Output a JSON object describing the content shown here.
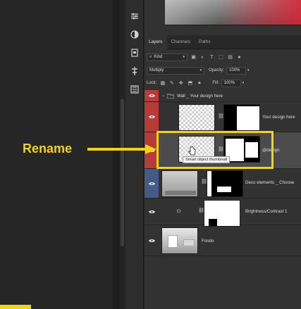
{
  "panel_tabs": [
    "Layers",
    "Channels",
    "Paths"
  ],
  "filter": {
    "kind_label": "Kind"
  },
  "blend": {
    "mode": "Multiply",
    "opacity_label": "Opacity:",
    "opacity_value": "100%"
  },
  "lock": {
    "label": "Lock:",
    "fill_label": "Fill:",
    "fill_value": "100%"
  },
  "layers": [
    {
      "name": "Wall _ Your design here",
      "type": "group"
    },
    {
      "name": "Your design here",
      "type": "smart-object"
    },
    {
      "name": "@design",
      "type": "smart-object",
      "selected": true
    },
    {
      "name": "Deco elements _ Choose",
      "type": "layer"
    },
    {
      "name": "Brightness/Contrast 1",
      "type": "adjustment"
    },
    {
      "name": "Fondo",
      "type": "image"
    }
  ],
  "annotation": {
    "label": "Rename",
    "tooltip": "Smart object thumbnail"
  },
  "colors": {
    "accent_yellow": "#f1d21c",
    "vis_red": "#b63c3c",
    "vis_blue": "#455a84"
  }
}
